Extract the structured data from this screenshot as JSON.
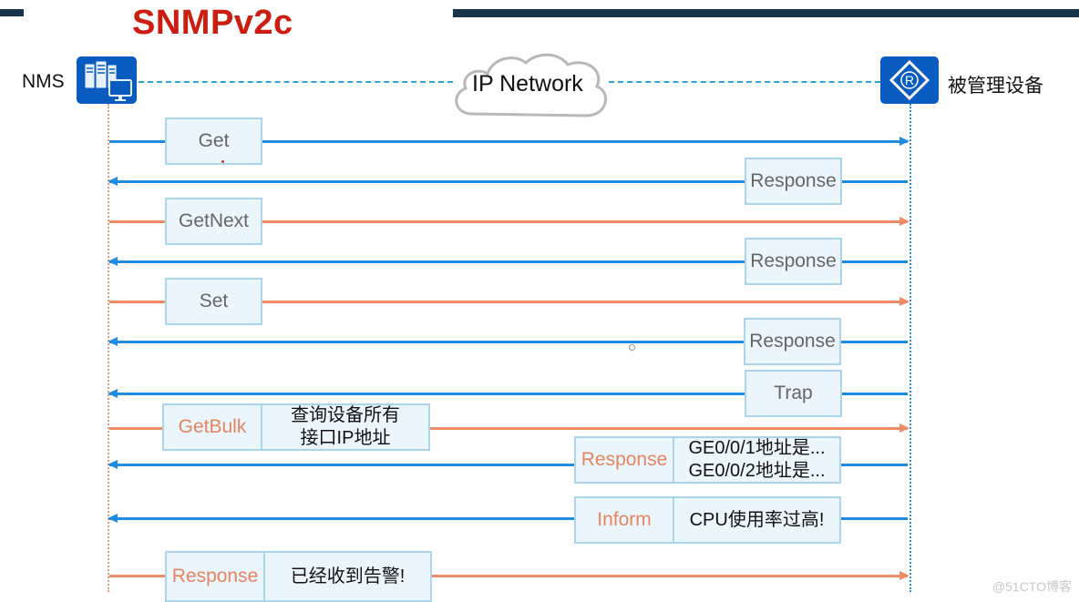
{
  "title": "SNMPv2c",
  "nodes": {
    "nms": {
      "label": "NMS",
      "icon": "server-workstation-icon"
    },
    "device": {
      "label": "被管理设备",
      "icon": "router-icon"
    },
    "network": {
      "label": "IP Network",
      "icon": "cloud-icon"
    }
  },
  "colors": {
    "title": "#cc1d10",
    "request_arrow": "#ee8b66",
    "response_arrow": "#1f8ce0",
    "header_bar": "#17344a",
    "icon_bg": "#0a5bc0",
    "box_fill": "#eaf6fc",
    "box_border": "#a9d6ec"
  },
  "messages": [
    {
      "label": "Get",
      "direction": "nms-to-device",
      "color": "blue",
      "label_color": "gray"
    },
    {
      "label": "Response",
      "direction": "device-to-nms",
      "color": "blue",
      "label_color": "gray"
    },
    {
      "label": "GetNext",
      "direction": "nms-to-device",
      "color": "orange",
      "label_color": "gray"
    },
    {
      "label": "Response",
      "direction": "device-to-nms",
      "color": "blue",
      "label_color": "gray"
    },
    {
      "label": "Set",
      "direction": "nms-to-device",
      "color": "orange",
      "label_color": "gray"
    },
    {
      "label": "Response",
      "direction": "device-to-nms",
      "color": "blue",
      "label_color": "gray"
    },
    {
      "label": "Trap",
      "direction": "device-to-nms",
      "color": "blue",
      "label_color": "gray"
    },
    {
      "label": "GetBulk",
      "detail": [
        "查询设备所有",
        "接口IP地址"
      ],
      "direction": "nms-to-device",
      "color": "orange",
      "label_color": "orange"
    },
    {
      "label": "Response",
      "detail": [
        "GE0/0/1地址是...",
        "GE0/0/2地址是..."
      ],
      "direction": "device-to-nms",
      "color": "blue",
      "label_color": "orange"
    },
    {
      "label": "Inform",
      "detail": [
        "CPU使用率过高!"
      ],
      "direction": "device-to-nms",
      "color": "blue",
      "label_color": "orange"
    },
    {
      "label": "Response",
      "detail": [
        "已经收到告警!"
      ],
      "direction": "nms-to-device",
      "color": "orange",
      "label_color": "orange"
    }
  ],
  "watermark": "@51CTO博客"
}
